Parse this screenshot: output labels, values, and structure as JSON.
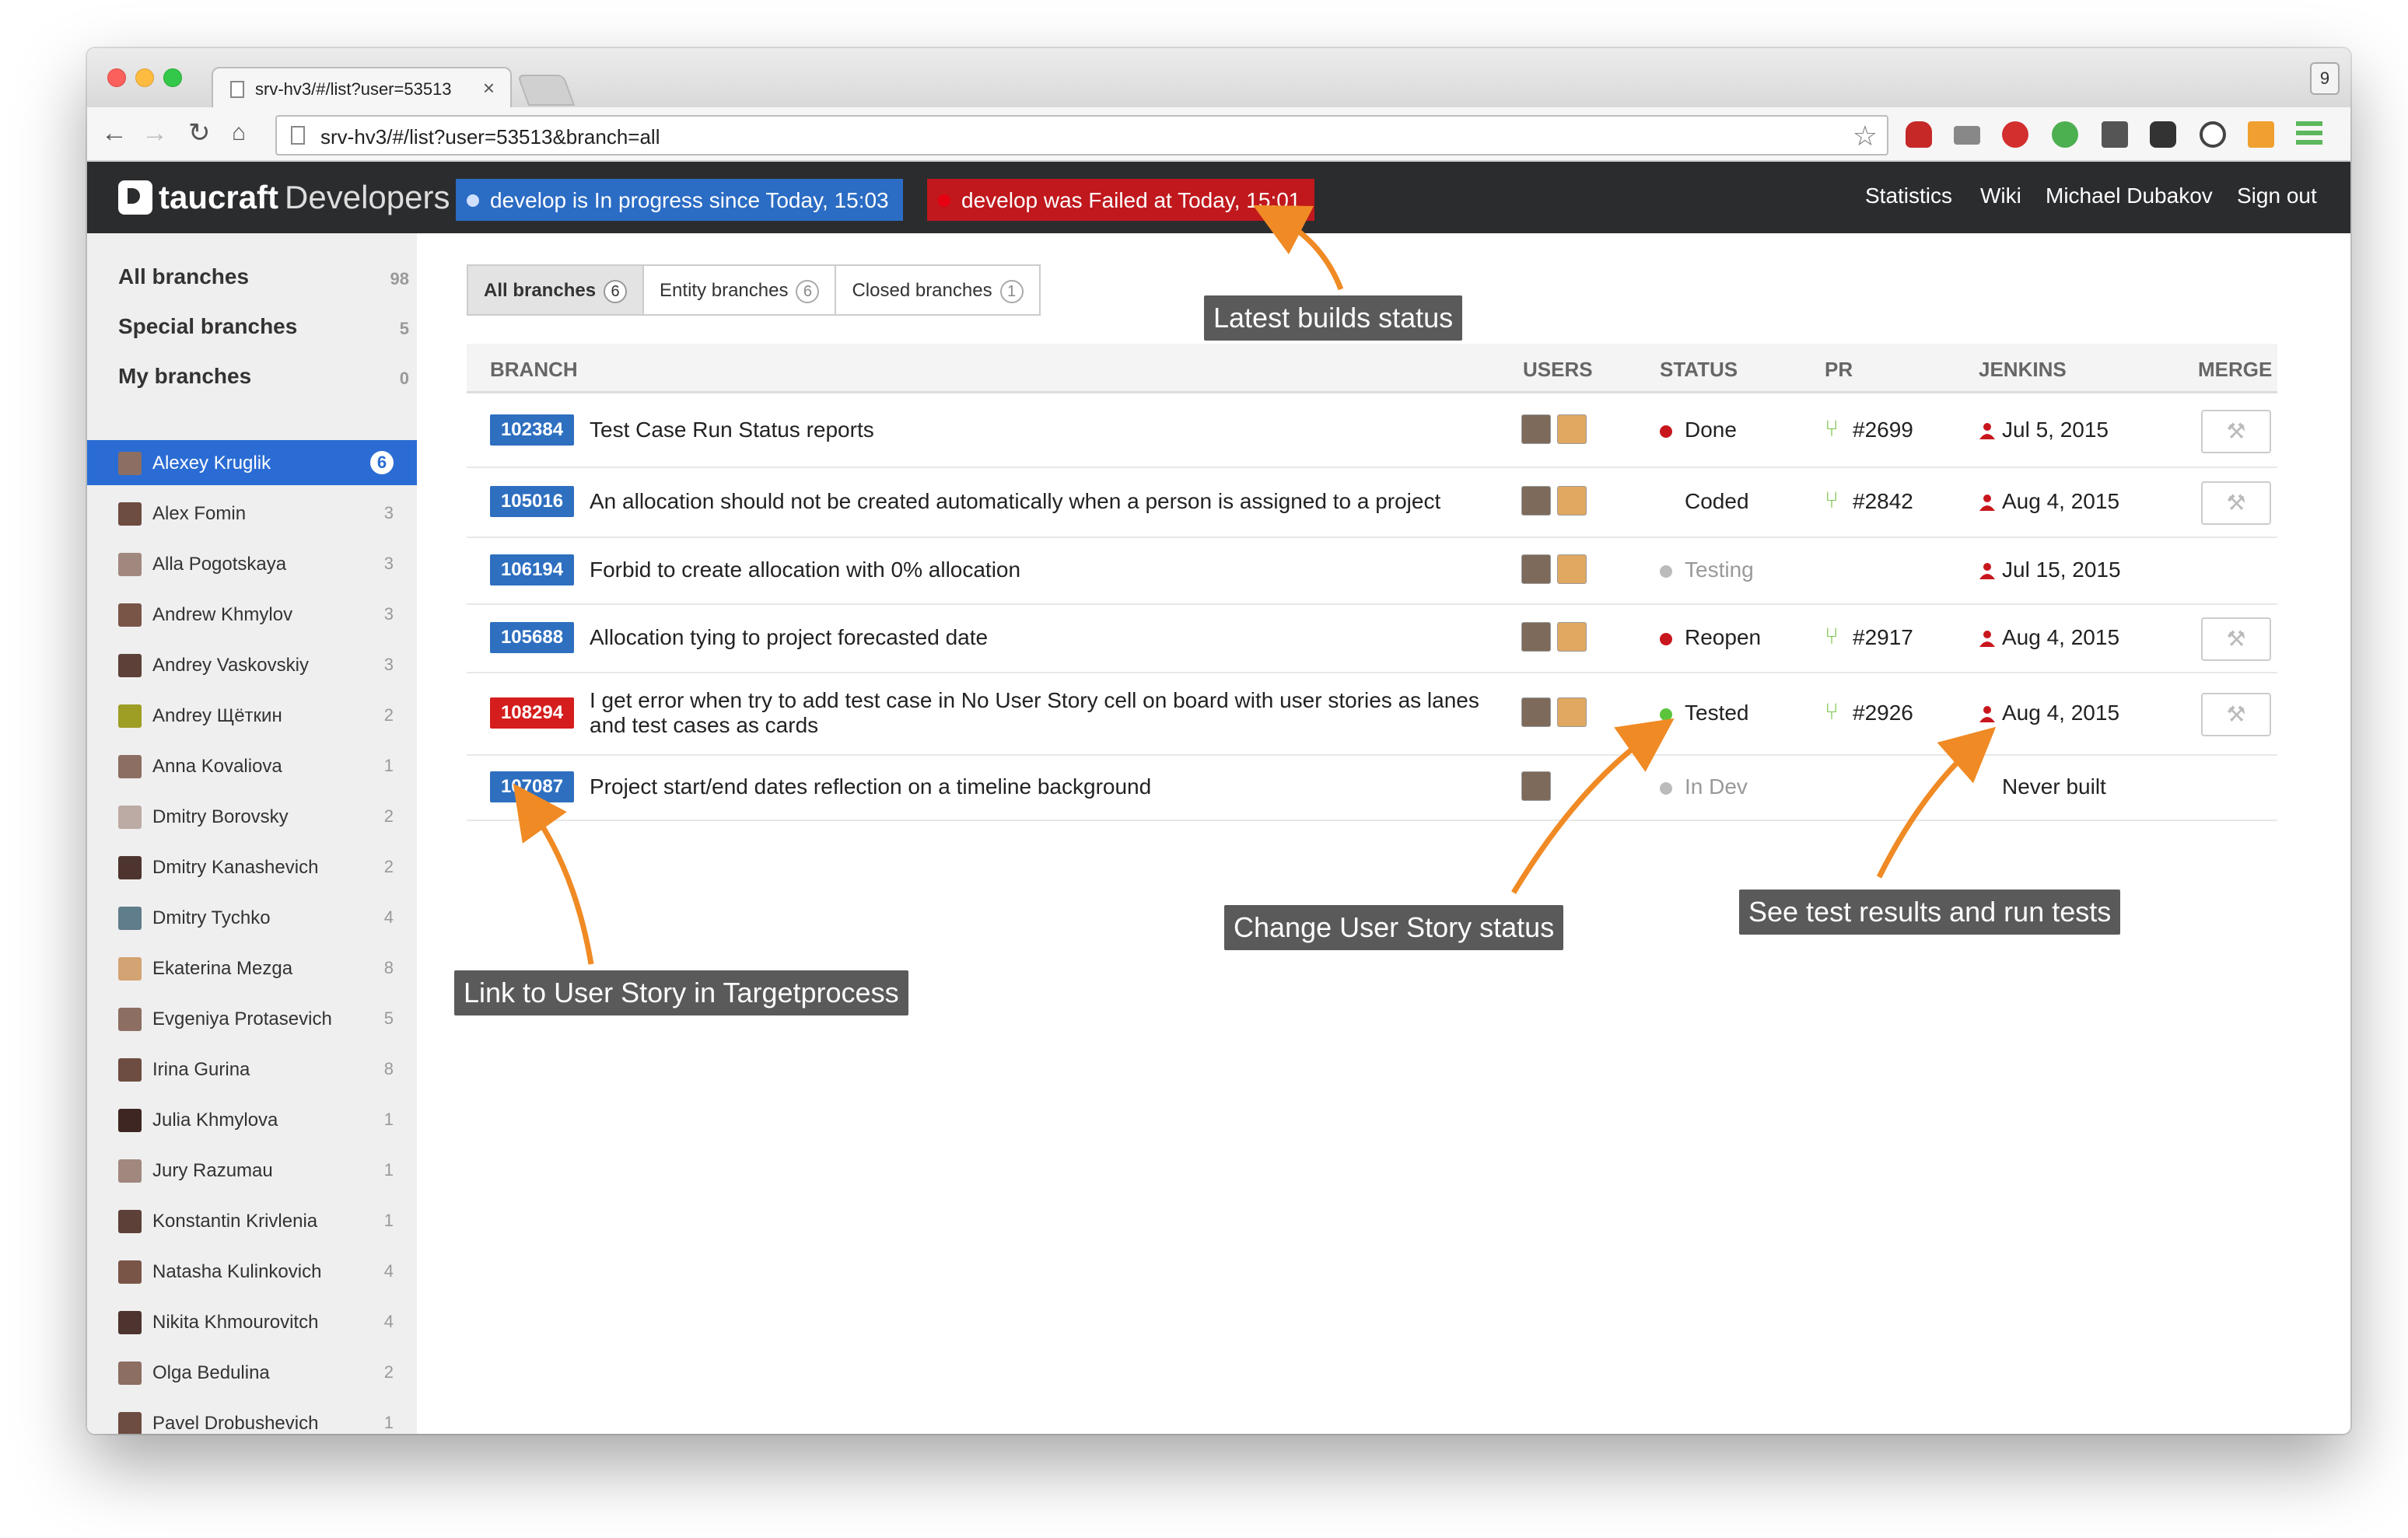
{
  "browser": {
    "tab_title": "srv-hv3/#/list?user=53513",
    "tab_close": "×",
    "url": "srv-hv3/#/list?user=53513&branch=all",
    "profile_badge": "9"
  },
  "header": {
    "brand": "taucraft",
    "section": "Developers",
    "builds": {
      "progress": "develop is In progress since Today, 15:03",
      "failed": "develop was Failed at Today, 15:01"
    },
    "links": [
      "Statistics",
      "Wiki",
      "Michael Dubakov",
      "Sign out"
    ]
  },
  "sidebar": {
    "groups": [
      {
        "label": "All branches",
        "count": "98"
      },
      {
        "label": "Special branches",
        "count": "5"
      },
      {
        "label": "My branches",
        "count": "0"
      }
    ],
    "users": [
      {
        "name": "Alexey Kruglik",
        "count": "6",
        "active": true
      },
      {
        "name": "Alex Fomin",
        "count": "3"
      },
      {
        "name": "Alla Pogotskaya",
        "count": "3"
      },
      {
        "name": "Andrew Khmylov",
        "count": "3"
      },
      {
        "name": "Andrey Vaskovskiy",
        "count": "3"
      },
      {
        "name": "Andrey Щёткин",
        "count": "2"
      },
      {
        "name": "Anna Kovaliova",
        "count": "1"
      },
      {
        "name": "Dmitry Borovsky",
        "count": "2"
      },
      {
        "name": "Dmitry Kanashevich",
        "count": "2"
      },
      {
        "name": "Dmitry Tychko",
        "count": "4"
      },
      {
        "name": "Ekaterina Mezga",
        "count": "8"
      },
      {
        "name": "Evgeniya Protasevich",
        "count": "5"
      },
      {
        "name": "Irina Gurina",
        "count": "8"
      },
      {
        "name": "Julia Khmylova",
        "count": "1"
      },
      {
        "name": "Jury Razumau",
        "count": "1"
      },
      {
        "name": "Konstantin Krivlenia",
        "count": "1"
      },
      {
        "name": "Natasha Kulinkovich",
        "count": "4"
      },
      {
        "name": "Nikita Khmourovitch",
        "count": "4"
      },
      {
        "name": "Olga Bedulina",
        "count": "2"
      },
      {
        "name": "Pavel Drobushevich",
        "count": "1"
      }
    ]
  },
  "filters": {
    "tabs": [
      {
        "label": "All branches",
        "count": "6",
        "active": true
      },
      {
        "label": "Entity branches",
        "count": "6"
      },
      {
        "label": "Closed branches",
        "count": "1"
      }
    ]
  },
  "table": {
    "columns": {
      "branch": "BRANCH",
      "users": "USERS",
      "status": "STATUS",
      "pr": "PR",
      "jenkins": "JENKINS",
      "merge": "MERGE"
    },
    "rows": [
      {
        "id": "102384",
        "title": "Test Case Run Status reports",
        "status": "Done",
        "pr": "#2699",
        "jenkins": "Jul 5, 2015"
      },
      {
        "id": "105016",
        "title": "An allocation should not be created automatically when a person is assigned to a project",
        "status": "Coded",
        "pr": "#2842",
        "jenkins": "Aug 4, 2015"
      },
      {
        "id": "106194",
        "title": "Forbid to create allocation with 0% allocation",
        "status": "Testing",
        "pr": "",
        "jenkins": "Jul 15, 2015"
      },
      {
        "id": "105688",
        "title": "Allocation tying to project forecasted date",
        "status": "Reopen",
        "pr": "#2917",
        "jenkins": "Aug 4, 2015"
      },
      {
        "id": "108294",
        "title": "I get error when try to add test case in No User Story cell on board with user stories as lanes and test cases as cards",
        "status": "Tested",
        "pr": "#2926",
        "jenkins": "Aug 4, 2015"
      },
      {
        "id": "107087",
        "title": "Project start/end dates reflection on a timeline background",
        "status": "In Dev",
        "pr": "",
        "jenkins": "Never built"
      }
    ]
  },
  "annotations": {
    "latest_builds": "Latest builds status",
    "change_status": "Change User Story status",
    "test_results": "See test results and run tests",
    "link_story": "Link to User Story in Targetprocess"
  },
  "colors": {
    "accent": "#2b6cd4",
    "failed": "#c0181d",
    "header_bg": "#2b2c2e",
    "annotation_arrow": "#f08a24",
    "status_done": "#c8161d",
    "status_tested": "#5cc43c",
    "status_inactive": "#bbbbbb"
  }
}
